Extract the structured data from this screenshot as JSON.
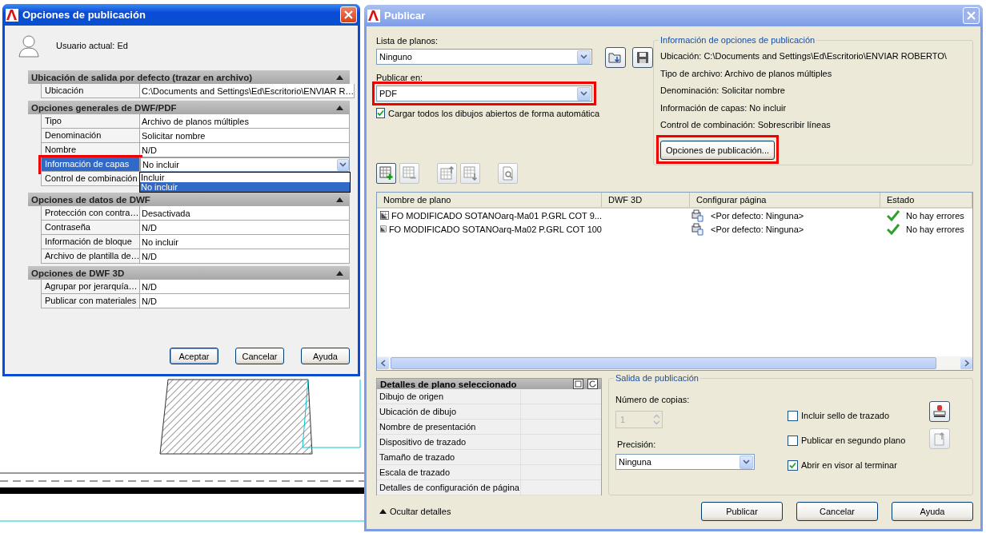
{
  "options_dialog": {
    "title": "Opciones de publicación",
    "active": true,
    "user_label": "Usuario actual: Ed",
    "sections": [
      {
        "title": "Ubicación de salida por defecto (trazar en archivo)",
        "expanded": true,
        "rows": [
          {
            "kind": "text",
            "label": "Ubicación",
            "value": "C:\\Documents and Settings\\Ed\\Escritorio\\ENVIAR R…",
            "selected": false,
            "highlighted": false
          }
        ]
      },
      {
        "title": "Opciones generales de DWF/PDF",
        "expanded": true,
        "rows": [
          {
            "kind": "text",
            "label": "Tipo",
            "value": "Archivo de planos múltiples",
            "selected": false,
            "highlighted": false
          },
          {
            "kind": "text",
            "label": "Denominación",
            "value": "Solicitar nombre",
            "selected": false,
            "highlighted": false
          },
          {
            "kind": "text",
            "label": "Nombre",
            "value": "N/D",
            "selected": false,
            "highlighted": false
          },
          {
            "kind": "combo",
            "label": "Información de capas",
            "value": "No incluir",
            "selected": true,
            "highlighted": true,
            "options": [
              {
                "label": "Incluir",
                "selected": false
              },
              {
                "label": "No incluir",
                "selected": true
              }
            ]
          },
          {
            "kind": "text",
            "label": "Control de combinación",
            "selected": false,
            "highlighted": false
          }
        ]
      },
      {
        "title": "Opciones de datos de DWF",
        "expanded": true,
        "rows": [
          {
            "kind": "text",
            "label": "Protección con contra…",
            "value": "Desactivada",
            "selected": false,
            "highlighted": false
          },
          {
            "kind": "text",
            "label": "Contraseña",
            "value": "N/D",
            "selected": false,
            "highlighted": false
          },
          {
            "kind": "text",
            "label": "Información de bloque",
            "value": "No incluir",
            "selected": false,
            "highlighted": false
          },
          {
            "kind": "text",
            "label": "Archivo de plantilla de…",
            "value": "N/D",
            "selected": false,
            "highlighted": false
          }
        ]
      },
      {
        "title": "Opciones de DWF 3D",
        "expanded": true,
        "rows": [
          {
            "kind": "text",
            "label": "Agrupar por jerarquía…",
            "value": "N/D",
            "selected": false,
            "highlighted": false
          },
          {
            "kind": "text",
            "label": "Publicar con materiales",
            "value": "N/D",
            "selected": false,
            "highlighted": false
          }
        ]
      }
    ],
    "buttons": [
      {
        "label": "Aceptar",
        "default": true
      },
      {
        "label": "Cancelar",
        "default": false
      },
      {
        "label": "Ayuda",
        "default": false
      }
    ]
  },
  "publish_dialog": {
    "title": "Publicar",
    "active": false,
    "sheet_list": {
      "label": "Lista de planos:",
      "value": "Ninguno",
      "highlighted": false
    },
    "publish_to": {
      "label": "Publicar en:",
      "value": "PDF",
      "highlighted": true
    },
    "auto_load": {
      "label": "Cargar todos los dibujos abiertos de forma automática",
      "checked": true
    },
    "info": {
      "title": "Información de opciones de publicación",
      "lines": [
        "Ubicación: C:\\Documents and Settings\\Ed\\Escritorio\\ENVIAR ROBERTO\\",
        "Tipo de archivo: Archivo de planos múltiples",
        "Denominación: Solicitar nombre",
        "Información de capas: No incluir",
        "Control de combinación: Sobrescribir líneas"
      ],
      "button": {
        "label": "Opciones de publicación...",
        "highlighted": true
      }
    },
    "table": {
      "columns": [
        "Nombre de plano",
        "DWF 3D",
        "Configurar página",
        "Estado"
      ],
      "rows": [
        {
          "name": "FO  MODIFICADO SOTANOarq-Ma01 P.GRL COT 9...",
          "page_setup": "<Por defecto: Ninguna>",
          "status": "No hay errores"
        },
        {
          "name": "FO  MODIFICADO SOTANOarq-Ma02 P.GRL COT 100",
          "page_setup": "<Por defecto: Ninguna>",
          "status": "No hay errores"
        }
      ]
    },
    "details": {
      "title": "Detalles de plano seleccionado",
      "rows": [
        "Dibujo de origen",
        "Ubicación de dibujo",
        "Nombre de presentación",
        "Dispositivo de trazado",
        "Tamaño de trazado",
        "Escala de trazado",
        "Detalles de configuración de página"
      ]
    },
    "output": {
      "title": "Salida de publicación",
      "copies_label": "Número de copias:",
      "copies": "1",
      "copies_disabled": true,
      "precision_label": "Precisión:",
      "precision": "Ninguna",
      "options": [
        {
          "label": "Incluir sello de trazado",
          "checked": false
        },
        {
          "label": "Publicar en segundo plano",
          "checked": false
        },
        {
          "label": "Abrir en visor al terminar",
          "checked": true
        }
      ]
    },
    "toggle_details": "Ocultar detalles",
    "buttons": [
      "Publicar",
      "Cancelar",
      "Ayuda"
    ]
  }
}
